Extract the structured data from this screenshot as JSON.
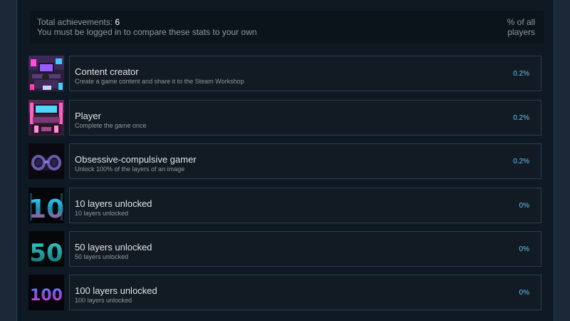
{
  "summary": {
    "total_label": "Total achievements: ",
    "total_value": "6",
    "login_note": "You must be logged in to compare these stats to your own",
    "pct_header": "% of all players"
  },
  "achievements": [
    {
      "name": "Content creator",
      "description": "Create a game content and share it to the Steam Workshop",
      "percent": "0.2%",
      "icon": "cyberpunk-room-icon"
    },
    {
      "name": "Player",
      "description": "Complete the game once",
      "percent": "0.2%",
      "icon": "neon-arcade-room-icon"
    },
    {
      "name": "Obsessive-compulsive gamer",
      "description": "Unlock 100% of the layers of an image",
      "percent": "0.2%",
      "icon": "neon-glasses-icon"
    },
    {
      "name": "10 layers unlocked",
      "description": "10 layers unlocked",
      "percent": "0%",
      "icon": "number-10-icon"
    },
    {
      "name": "50 layers unlocked",
      "description": "50 layers unlocked",
      "percent": "0%",
      "icon": "number-50-icon"
    },
    {
      "name": "100 layers unlocked",
      "description": "100 layers unlocked",
      "percent": "0%",
      "icon": "number-100-icon"
    }
  ],
  "colors": {
    "background": "#1b2838",
    "panel": "#0f1923",
    "card": "#121b24",
    "card_border": "#2b3d4f",
    "percent_blue": "#66c0f4",
    "muted_text": "#8f98a0"
  }
}
